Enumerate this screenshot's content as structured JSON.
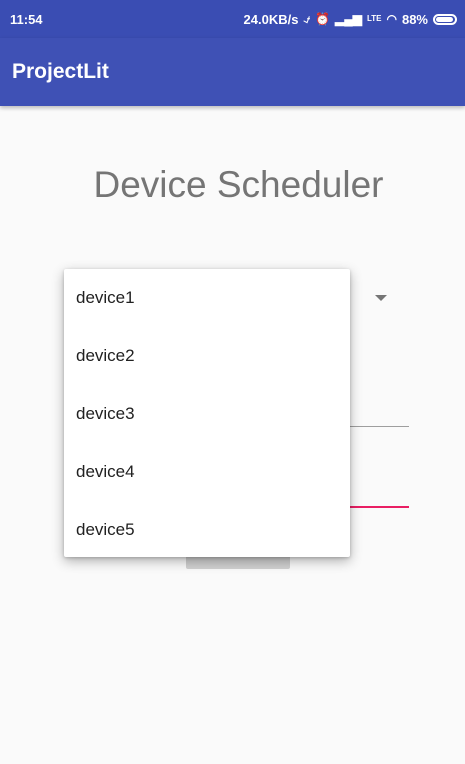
{
  "status_bar": {
    "time": "11:54",
    "network_speed": "24.0KB/s",
    "battery_percent": "88%",
    "icons": [
      "mute-icon",
      "alarm-icon",
      "signal-icon",
      "volte-icon",
      "wifi-icon",
      "battery-icon"
    ],
    "volte_label": "LTE"
  },
  "app_bar": {
    "title": "ProjectLit"
  },
  "main": {
    "title": "Device Scheduler"
  },
  "dropdown": {
    "options": [
      "device1",
      "device2",
      "device3",
      "device4",
      "device5"
    ]
  },
  "colors": {
    "primary": "#3f51b5",
    "primary_dark": "#3a4db3",
    "accent": "#e91e63"
  }
}
